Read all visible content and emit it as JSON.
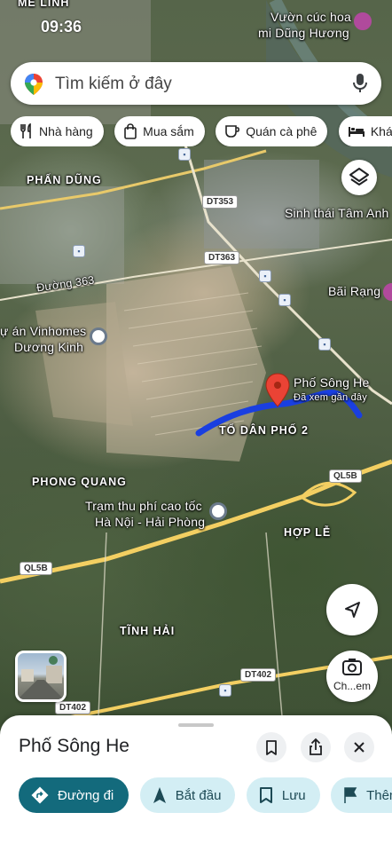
{
  "status_bar": {
    "time": "09:36"
  },
  "search": {
    "placeholder": "Tìm kiếm ở đây"
  },
  "chips": [
    {
      "label": "Nhà hàng",
      "icon": "fork-knife-icon"
    },
    {
      "label": "Mua sắm",
      "icon": "shopping-bag-icon"
    },
    {
      "label": "Quán cà phê",
      "icon": "coffee-cup-icon"
    },
    {
      "label": "Khác",
      "icon": "bed-icon"
    }
  ],
  "map": {
    "labels": {
      "me_linh": "MÊ LINH",
      "vuon_1": "Vườn cúc hoa",
      "vuon_2": "mi Dũng Hương",
      "phan_dung": "PHẤN DŨNG",
      "sinh_thai": "Sinh thái Tâm Anh",
      "duong_363": "Đường 363",
      "bai_rang": "Bãi Rạng",
      "vinhomes_1": "ự án Vinhomes",
      "vinhomes_2": "Dương Kinh",
      "pho_song_he": "Phố Sông He",
      "recently_viewed": "Đã xem gần đây",
      "to_dan_pho": "TỔ DÂN PHỐ 2",
      "phong_quang": "PHONG QUANG",
      "tram_1": "Trạm thu phí cao tốc",
      "tram_2": "Hà Nội - Hải Phòng",
      "hop_le": "HỢP LỄ",
      "tinh_hai": "TĨNH HẢI"
    },
    "shields": {
      "dt353": "DT353",
      "dt363": "DT363",
      "ql5b_right": "QL5B",
      "ql5b_left": "QL5B",
      "dt402_right": "DT402",
      "dt402_left": "DT402"
    },
    "route_color": "#1a3fe0",
    "pin_color": "#ea4335"
  },
  "lens_button": {
    "label": "Ch...em"
  },
  "place_sheet": {
    "title": "Phố Sông He",
    "actions": [
      {
        "label": "Đường đi",
        "icon": "directions-icon",
        "primary": true
      },
      {
        "label": "Bắt đầu",
        "icon": "navigation-arrow-icon"
      },
      {
        "label": "Lưu",
        "icon": "bookmark-icon"
      },
      {
        "label": "Thêm",
        "icon": "flag-icon"
      }
    ]
  }
}
